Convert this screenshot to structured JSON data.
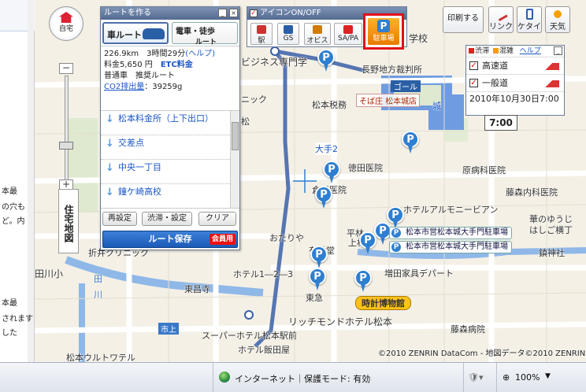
{
  "left_strip": {
    "texts": [
      "本最",
      "の穴も",
      "ど。内",
      "本最",
      "されます",
      "した"
    ]
  },
  "home": {
    "label": "自宅"
  },
  "zoom": {
    "plus": "+",
    "minus": "−",
    "layer_label": "住宅地図"
  },
  "route_panel": {
    "title": "ルートを作る",
    "mode_car": "車ルート",
    "mode_train": "電車・徒歩",
    "mode_train_sub": "ルート",
    "distance_time": "226.9km　3時間29分",
    "help": "(ヘルプ)",
    "fee_label": "料金5,650 円",
    "etc": "ETC料金",
    "road": "普通車　推奨ルート",
    "co2_link": "CO2排出量",
    "co2_value": "：39259g",
    "steps": [
      "松本料金所（上下出口）",
      "交差点",
      "中央一丁目",
      "鐘ケ崎高校"
    ],
    "btn_reset": "再設定",
    "btn_traffic": "渋滞・設定",
    "btn_clear": "クリア",
    "btn_save": "ルート保存",
    "member_badge": "会員用"
  },
  "icon_bar": {
    "title": "アイコンON/OFF",
    "items": [
      {
        "label": "駅",
        "color": "#c33"
      },
      {
        "label": "GS",
        "color": "#2a5fa6"
      },
      {
        "label": "オビス",
        "color": "#d47a00"
      },
      {
        "label": "SA/PA",
        "color": "#d22"
      }
    ],
    "parking": {
      "icon": "P",
      "label": "駐車場"
    }
  },
  "tools": {
    "print": "印刷する",
    "link": "リンク",
    "mobile": "ケタイ",
    "weather": "天気"
  },
  "traffic": {
    "legend_jam": "渋滞",
    "legend_congest": "混雑",
    "help": "ヘルプ",
    "highway": "高速道",
    "general": "一般道",
    "datetime": "2010年10月30日7:00",
    "time_flag": "7:00",
    "colors": {
      "jam": "#d22",
      "congest": "#f3a000"
    }
  },
  "map": {
    "labels": [
      {
        "text": "ビジネス専門学",
        "key": "l1"
      },
      {
        "text": "長野地方裁判所",
        "key": "l2"
      },
      {
        "text": "学校",
        "key": "l3"
      },
      {
        "text": "ゴール",
        "key": "goal"
      },
      {
        "text": "松本税務",
        "key": "l4"
      },
      {
        "text": "そば庄 松本城店",
        "key": "l5"
      },
      {
        "text": "城",
        "key": "l6"
      },
      {
        "text": "ニック",
        "key": "l7"
      },
      {
        "text": "松",
        "key": "l8"
      },
      {
        "text": "大手2",
        "key": "l9"
      },
      {
        "text": "徳田医院",
        "key": "l10"
      },
      {
        "text": "原病科医院",
        "key": "l11"
      },
      {
        "text": "倉田医院",
        "key": "l12"
      },
      {
        "text": "藤森内科医院",
        "key": "l13"
      },
      {
        "text": "ホテルアルモニービアン",
        "key": "l14"
      },
      {
        "text": "華のゆうじ",
        "key": "l15"
      },
      {
        "text": "はしご横丁",
        "key": "l16"
      },
      {
        "text": "おたりや",
        "key": "l17"
      },
      {
        "text": "平林",
        "key": "l18"
      },
      {
        "text": "上村",
        "key": "l19"
      },
      {
        "text": "有林堂",
        "key": "l20"
      },
      {
        "text": "折井クリニック",
        "key": "l21"
      },
      {
        "text": "田川小",
        "key": "l22"
      },
      {
        "text": "ホテル1―2―3",
        "key": "l23"
      },
      {
        "text": "増田家具デパート",
        "key": "l24"
      },
      {
        "text": "東昌寺",
        "key": "l25"
      },
      {
        "text": "東急",
        "key": "l26"
      },
      {
        "text": "時計博物館",
        "key": "l27"
      },
      {
        "text": "リッチモンドホテル松本",
        "key": "l28"
      },
      {
        "text": "市上",
        "key": "l29"
      },
      {
        "text": "スーパーホテル松本駅前",
        "key": "l30"
      },
      {
        "text": "ホテル飯田屋",
        "key": "l31"
      },
      {
        "text": "松本ウルトワテル",
        "key": "l32"
      },
      {
        "text": "藤森病院",
        "key": "l33"
      },
      {
        "text": "鎮神社",
        "key": "l34"
      },
      {
        "text": "田",
        "key": "l35"
      },
      {
        "text": "川",
        "key": "l36"
      }
    ],
    "parking_tags": [
      "松本市営松本城大手門駐車場",
      "松本市営松本城大手門駐車場"
    ],
    "pin_letter": "P",
    "copyright": "©2010 ZENRIN DataCom - 地図データ©2010 ZENRIN"
  },
  "statusbar": {
    "zone": "インターネット｜保護モード: 有効",
    "zoom": "100%",
    "zoom_arrow": "▼"
  }
}
